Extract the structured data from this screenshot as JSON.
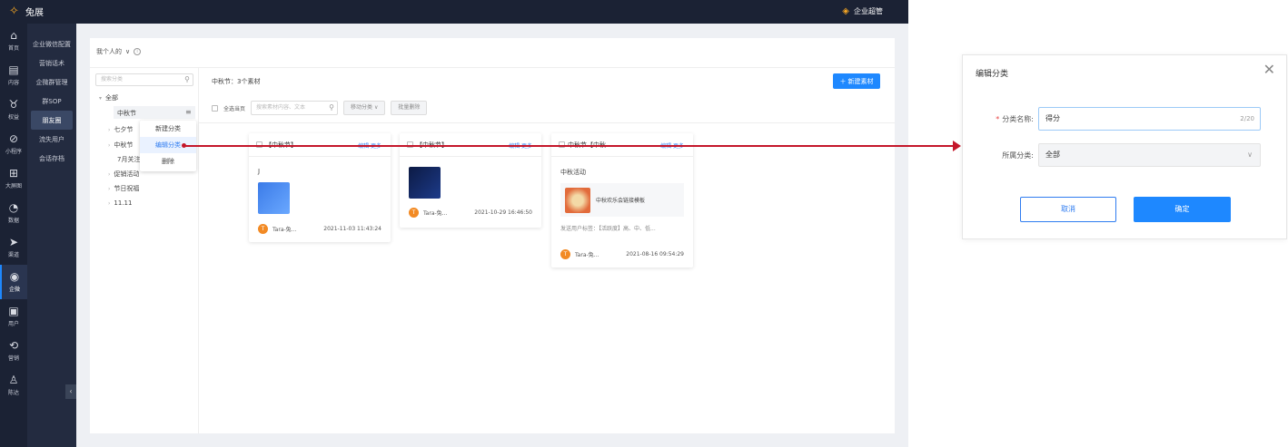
{
  "topbar": {
    "logo_text": "兔展",
    "admin_label": "企业超管"
  },
  "nav": {
    "items": [
      {
        "label": "首页",
        "icon": "⌂"
      },
      {
        "label": "内容",
        "icon": "▤"
      },
      {
        "label": "权益",
        "icon": "♉"
      },
      {
        "label": "小程序",
        "icon": "⊘"
      },
      {
        "label": "大屏图",
        "icon": "⊞"
      },
      {
        "label": "数据",
        "icon": "◔"
      },
      {
        "label": "渠道",
        "icon": "➤"
      },
      {
        "label": "企微",
        "icon": "◉"
      },
      {
        "label": "用户",
        "icon": "▣"
      },
      {
        "label": "营销",
        "icon": "⟲"
      },
      {
        "label": "陈达",
        "icon": "♙"
      }
    ]
  },
  "subnav": {
    "items": [
      "企业微信配置",
      "营销话术",
      "企微群管理",
      "群SOP",
      "朋友圈",
      "流失用户",
      "会话存档"
    ],
    "active_index": 4
  },
  "breadcrumb": {
    "label": "我个人的",
    "chevron": "∨",
    "info": "i"
  },
  "tree": {
    "search_placeholder": "搜索分类",
    "nodes": [
      {
        "label": "全部",
        "arrow": "▾"
      },
      {
        "label": "中秋节",
        "arrow": ""
      },
      {
        "label": "七夕节",
        "arrow": "›"
      },
      {
        "label": "中秋节",
        "arrow": "›"
      },
      {
        "label": "7月关注",
        "arrow": ""
      },
      {
        "label": "促销活动",
        "arrow": "›"
      },
      {
        "label": "节日祝福",
        "arrow": "›"
      },
      {
        "label": "11.11",
        "arrow": "›"
      }
    ],
    "kebab": "≡"
  },
  "context_menu": {
    "items": [
      "新建分类",
      "编辑分类",
      "删除"
    ]
  },
  "main": {
    "heading": "中秋节：3个素材",
    "add_button": "新建素材",
    "toolbar": {
      "select_all": "全选当页",
      "search_placeholder": "搜索素材内容、文本",
      "move_label": "移动分类",
      "batch_delete": "批量删除"
    }
  },
  "cards": [
    {
      "title": "【中秋节】",
      "ops": "编辑  更多",
      "text": "J",
      "author": "Tara-兔...",
      "timestamp": "2021-11-03 11:43:24"
    },
    {
      "title": "【中秋节】",
      "ops": "编辑  更多",
      "text": "",
      "author": "Tara-兔...",
      "timestamp": "2021-10-29 16:46:50"
    },
    {
      "title": "中秋节【中秋...",
      "ops": "编辑  更多",
      "text": "中秋活动",
      "link_title": "中秋欢乐会链接模板",
      "desc": "发送用户标签：【活跃度】高、中、低...",
      "author": "Tara-兔...",
      "timestamp": "2021-08-16 09:54:29"
    }
  ],
  "dialog": {
    "title": "编辑分类",
    "close": "✕",
    "name_label": "分类名称:",
    "name_required": "*",
    "name_value": "得分",
    "name_count": "2/20",
    "parent_label": "所属分类:",
    "parent_value": "全部",
    "cancel": "取消",
    "confirm": "确定"
  },
  "colors": {
    "primary": "#1e88ff",
    "sidebar": "#1b2234",
    "annotation": "#c4162a"
  }
}
